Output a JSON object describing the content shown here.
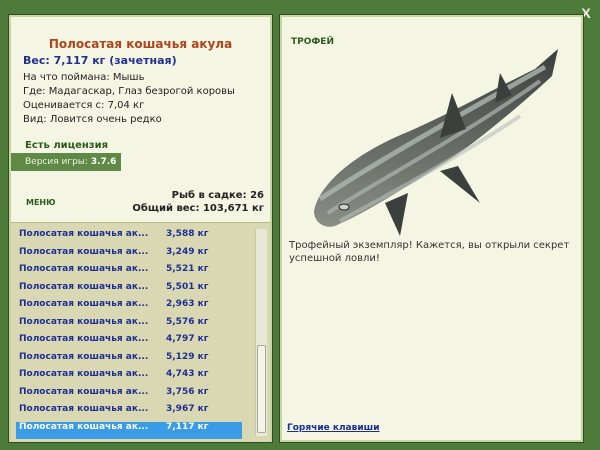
{
  "close": {
    "label": "X"
  },
  "fish": {
    "title": "Полосатая кошачья акула",
    "weight_line": "Вес: 7,117 кг (зачетная)",
    "bait": "На что поймана: Мышь",
    "place": "Где: Мадагаскар, Глаз безрогой коровы",
    "value": "Оценивается с: 7,04 кг",
    "rarity": "Вид: Ловится очень редко"
  },
  "license": "Есть лицензия",
  "version": {
    "label": "Версия игры:",
    "number": "3.7.6"
  },
  "menu": "МЕНЮ",
  "stats": {
    "net_count": "Рыб в садке: 26",
    "total_weight": "Общий вес: 103,671 кг"
  },
  "catch_list": [
    {
      "name": "Полосатая кошачья ак...",
      "weight": "3,588 кг"
    },
    {
      "name": "Полосатая кошачья ак...",
      "weight": "3,249 кг"
    },
    {
      "name": "Полосатая кошачья ак...",
      "weight": "5,521 кг"
    },
    {
      "name": "Полосатая кошачья ак...",
      "weight": "5,501 кг"
    },
    {
      "name": "Полосатая кошачья ак...",
      "weight": "2,963 кг"
    },
    {
      "name": "Полосатая кошачья ак...",
      "weight": "5,576 кг"
    },
    {
      "name": "Полосатая кошачья ак...",
      "weight": "4,797 кг"
    },
    {
      "name": "Полосатая кошачья ак...",
      "weight": "5,129 кг"
    },
    {
      "name": "Полосатая кошачья ак...",
      "weight": "4,743 кг"
    },
    {
      "name": "Полосатая кошачья ак...",
      "weight": "3,756 кг"
    },
    {
      "name": "Полосатая кошачья ак...",
      "weight": "3,967 кг"
    },
    {
      "name": "Полосатая кошачья ак...",
      "weight": "7,117 кг",
      "selected": true
    }
  ],
  "trophy": {
    "label": "ТРОФЕЙ",
    "message": "Трофейный экземпляр! Кажется, вы открыли секрет успешной ловли!"
  },
  "hotkeys": "Горячие клавиши",
  "colors": {
    "background": "#4e7a3a",
    "panel": "#f5f5e3",
    "list": "#d9d8b2",
    "selected": "#3a9be6",
    "title": "#b0441c",
    "link": "#1a2f91"
  },
  "icons": {
    "close": "close-icon",
    "fish": "shark-image"
  }
}
